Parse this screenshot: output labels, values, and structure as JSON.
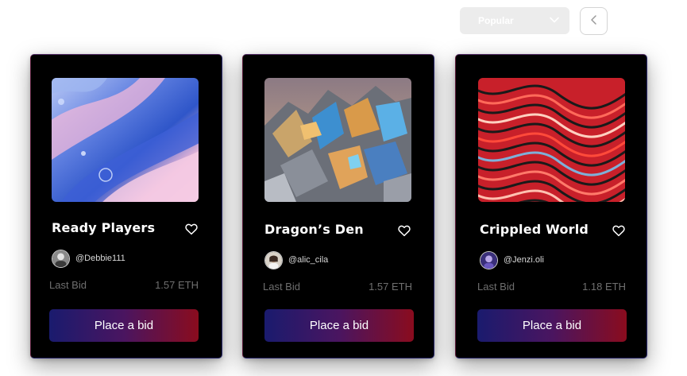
{
  "toolbar": {
    "sort_label": "Popular",
    "sort_icon": "chevron-down-icon",
    "prev_icon": "chevron-left-icon"
  },
  "cards": [
    {
      "title": "Ready Players",
      "handle": "@Debbie111",
      "last_bid_label": "Last Bid",
      "last_bid_value": "1.57 ETH",
      "button_label": "Place a bid",
      "art": "marbled-pink-blue-abstract",
      "avatar": "avatar-grayscale-man"
    },
    {
      "title": "Dragon’s Den",
      "handle": "@alic_cila",
      "last_bid_label": "Last Bid",
      "last_bid_value": "1.57 ETH",
      "button_label": "Place a bid",
      "art": "iridescent-crumpled-foil",
      "avatar": "avatar-woman"
    },
    {
      "title": "Crippled World",
      "handle": "@Jenzi.oli",
      "last_bid_label": "Last Bid",
      "last_bid_value": "1.18 ETH",
      "button_label": "Place a bid",
      "art": "red-wavy-lines-abstract",
      "avatar": "avatar-purple"
    }
  ],
  "colors": {
    "card_bg": "#000000",
    "button_gradient_start": "#1a1b6e",
    "button_gradient_end": "#8a0c1e",
    "muted_text": "#6f6f6f"
  }
}
